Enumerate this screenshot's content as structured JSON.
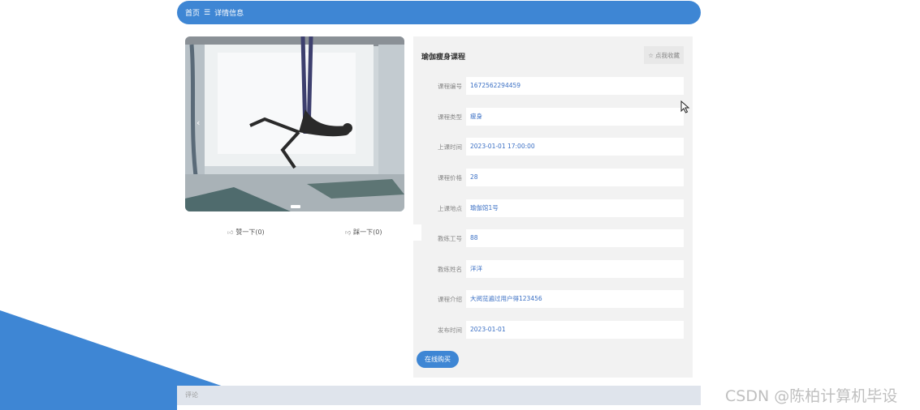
{
  "breadcrumb": {
    "home": "首页",
    "separator": "☰",
    "current": "详情信息"
  },
  "gallery": {
    "image_name": "aerial-yoga-photo",
    "prev_arrow": "‹"
  },
  "votes": {
    "like_label": "赞一下(0)",
    "dislike_label": "踩一下(0)"
  },
  "course": {
    "title": "瑜伽瘦身课程",
    "favorite_label": "点我收藏",
    "fields": [
      {
        "label": "课程编号",
        "value": "1672562294459"
      },
      {
        "label": "课程类型",
        "value": "瘦身"
      },
      {
        "label": "上课时间",
        "value": "2023-01-01 17:00:00"
      },
      {
        "label": "课程价格",
        "value": "28"
      },
      {
        "label": "上课地点",
        "value": "瑜伽馆1号"
      },
      {
        "label": "教练工号",
        "value": "88"
      },
      {
        "label": "教练姓名",
        "value": "洋洋"
      },
      {
        "label": "课程介绍",
        "value": "大阅览遍过用户得123456"
      },
      {
        "label": "发布时间",
        "value": "2023-01-01"
      }
    ],
    "buy_label": "在线购买"
  },
  "comments": {
    "label": "评论"
  },
  "watermark": "CSDN @陈柏计算机毕设",
  "colors": {
    "accent": "#3e86d4",
    "panel_bg": "#f2f2f2",
    "value_text": "#3a6fc4"
  }
}
